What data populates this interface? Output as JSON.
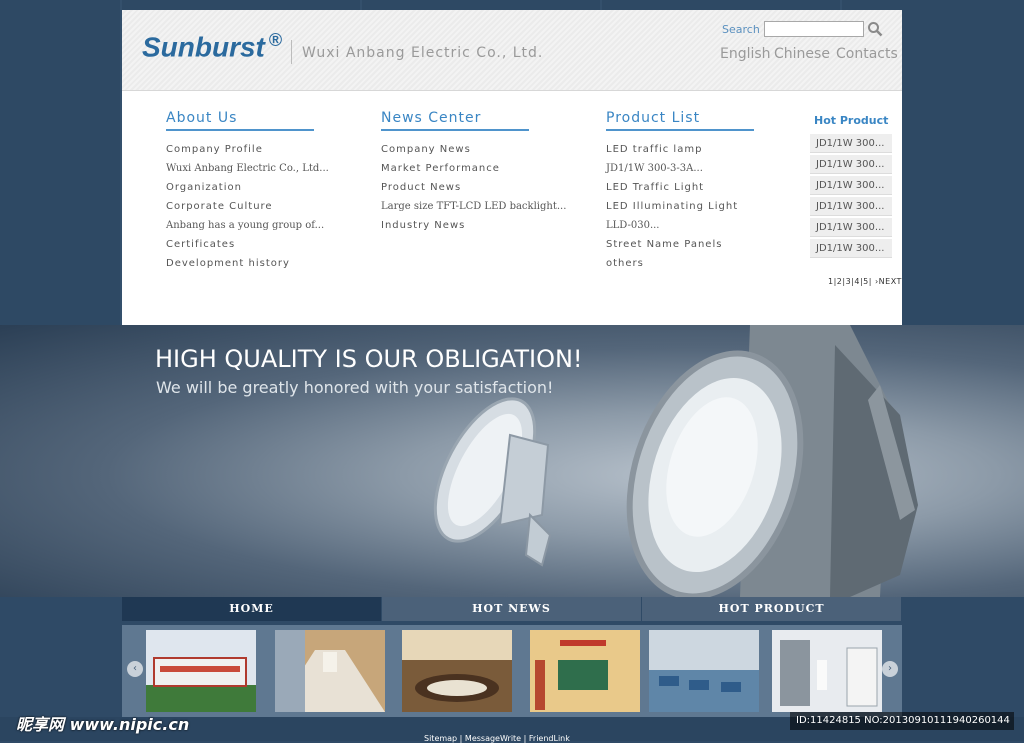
{
  "header": {
    "logo": "Sunburst",
    "logo_mark": "®",
    "company": "Wuxi Anbang Electric Co., Ltd.",
    "search_label": "Search",
    "languages": [
      "English",
      "Chinese",
      "Contacts"
    ]
  },
  "menus": [
    {
      "title": "About Us",
      "items": [
        "Company Profile",
        "Wuxi Anbang Electric Co., Ltd...",
        "Organization",
        "Corporate Culture",
        "Anbang has a young group of...",
        "Certificates",
        "Development history"
      ]
    },
    {
      "title": "News Center",
      "items": [
        "Company News",
        "Market Performance",
        "Product News",
        "Large size TFT-LCD LED backlight...",
        "Industry News"
      ]
    },
    {
      "title": "Product List",
      "items": [
        "LED traffic lamp",
        "JD1/1W 300-3-3A...",
        "LED Traffic Light",
        "LED Illuminating Light",
        "LLD-030...",
        "Street Name Panels",
        "others"
      ]
    }
  ],
  "hot_product": {
    "title": "Hot Product",
    "items": [
      "JD1/1W 300...",
      "JD1/1W 300...",
      "JD1/1W 300...",
      "JD1/1W 300...",
      "JD1/1W 300...",
      "JD1/1W 300..."
    ],
    "pager": "1|2|3|4|5| ›NEXT"
  },
  "banner": {
    "headline": "HIGH QUALITY IS OUR OBLIGATION!",
    "subline": "We will be greatly honored with your satisfaction!"
  },
  "tabs": [
    "HOME",
    "HOT NEWS",
    "HOT PRODUCT"
  ],
  "gallery": {
    "prev_glyph": "‹",
    "next_glyph": "›"
  },
  "footer": {
    "links": "Sitemap | MessageWrite | FriendLink"
  },
  "watermark": {
    "left": "昵享网 www.nipic.cn",
    "right": "ID:11424815 NO:20130910111940260144"
  }
}
